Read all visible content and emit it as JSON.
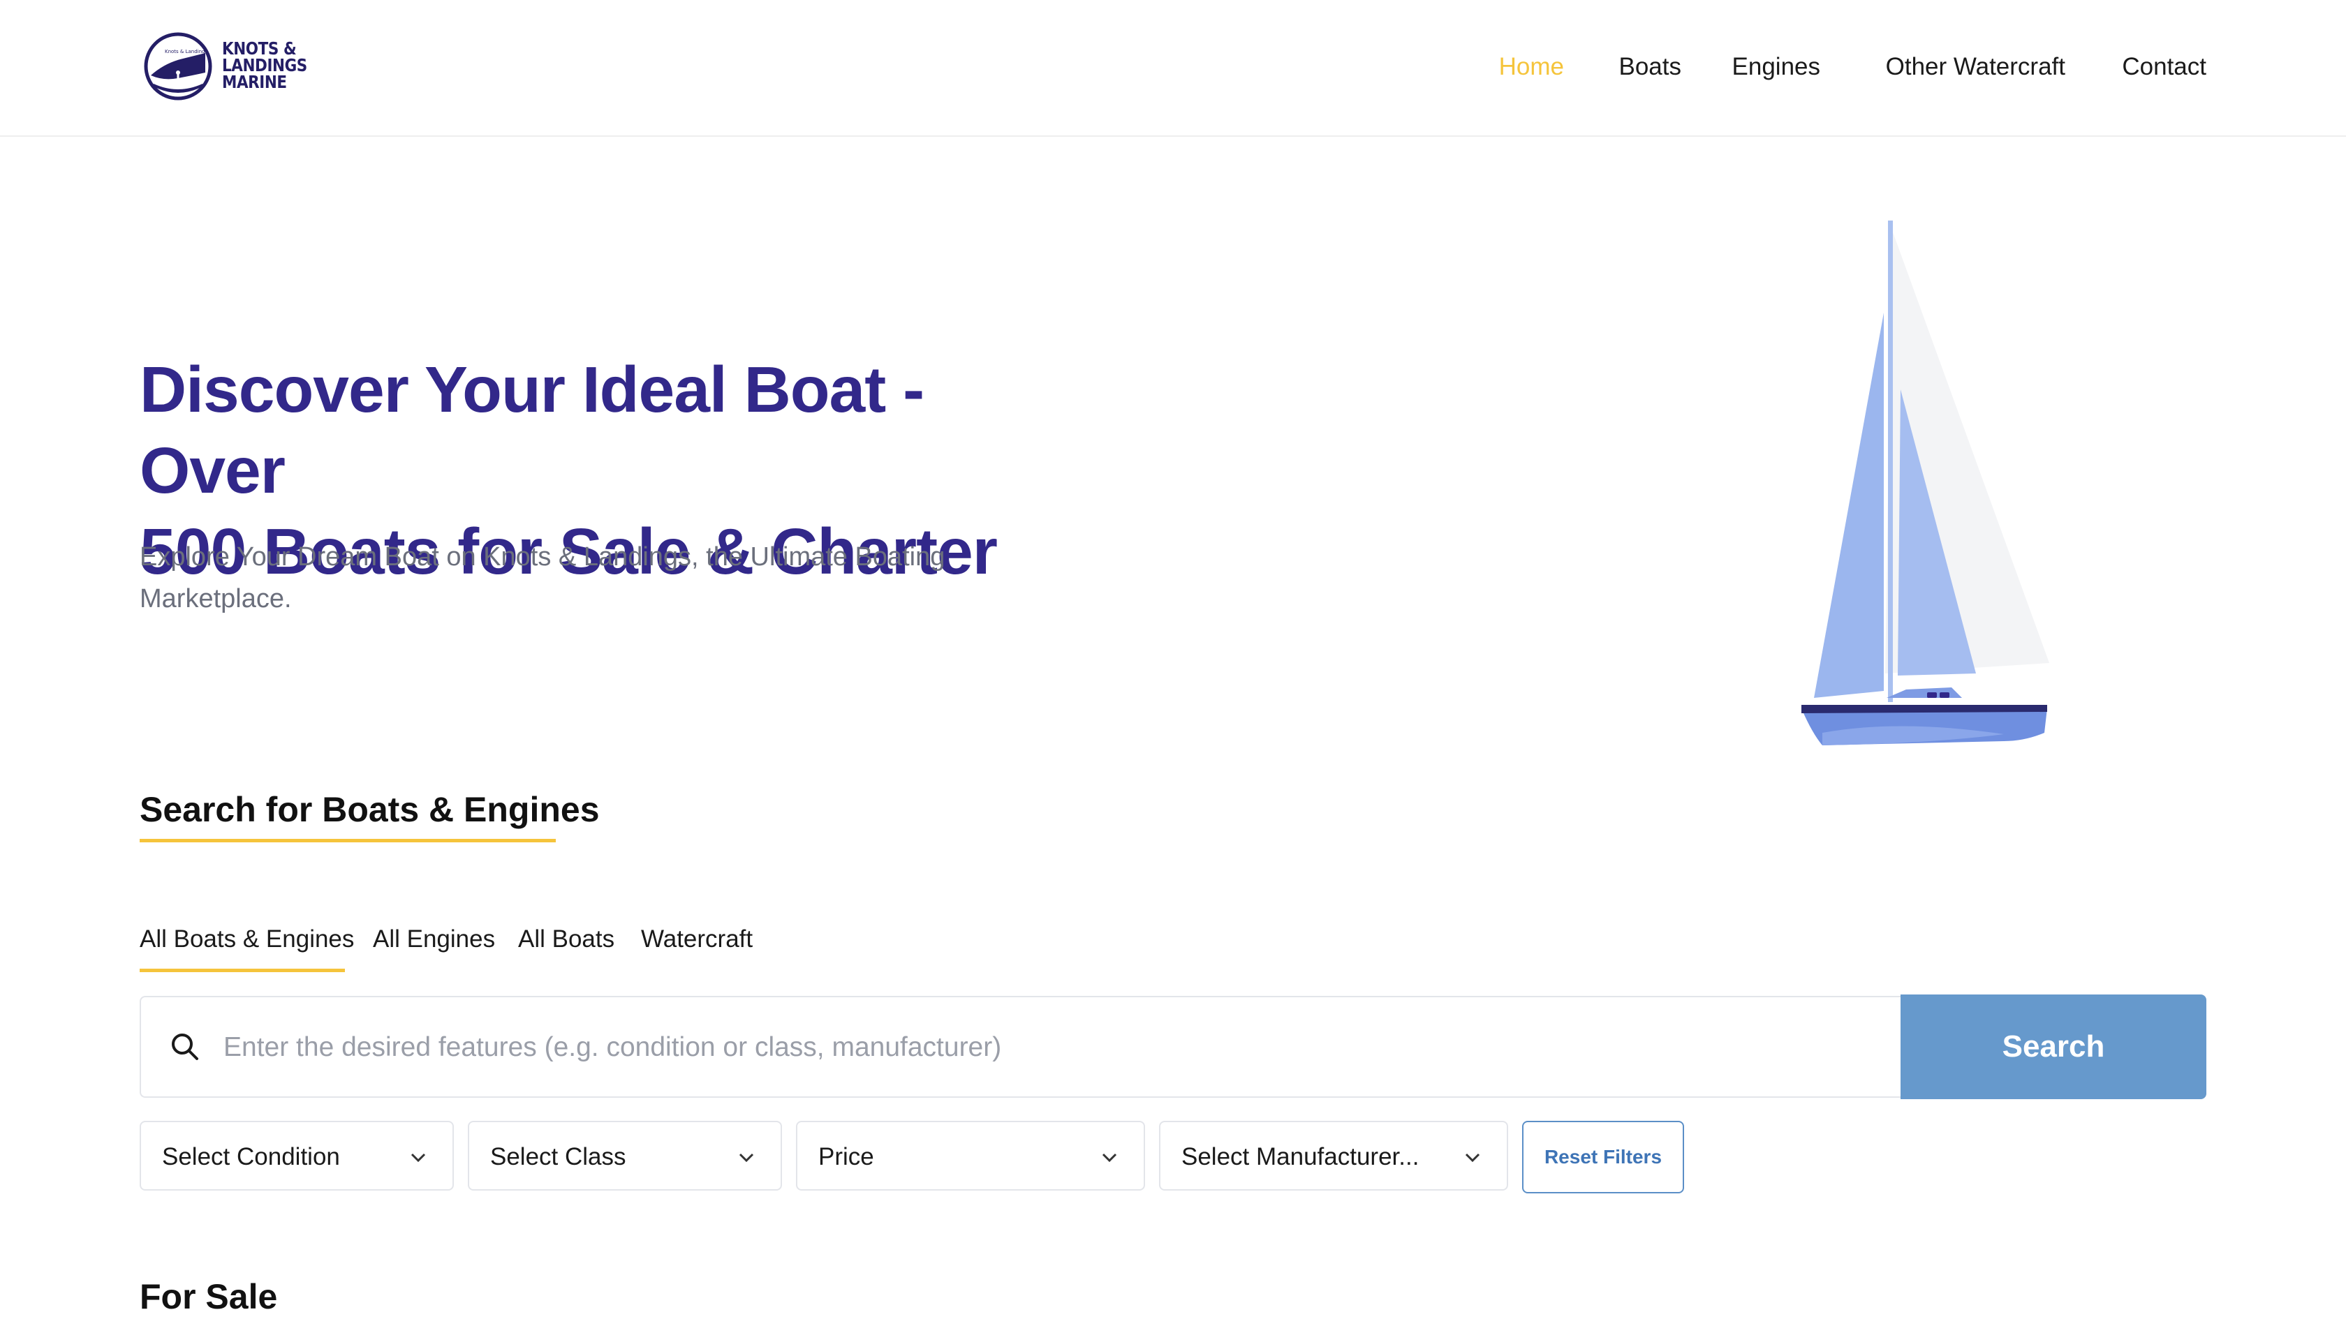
{
  "brand": {
    "logo_lines": [
      "KNOTS &",
      "LANDINGS",
      "MARINE"
    ]
  },
  "nav": {
    "items": [
      {
        "label": "Home",
        "active": true
      },
      {
        "label": "Boats",
        "active": false
      },
      {
        "label": "Engines",
        "active": false
      },
      {
        "label": "Other Watercraft",
        "active": false
      },
      {
        "label": "Contact",
        "active": false
      }
    ]
  },
  "hero": {
    "title_line1": "Discover Your Ideal Boat - Over",
    "title_line2": "500 Boats for Sale & Charter",
    "subtitle_line1": "Explore Your Dream Boat on Knots & Landings, the Ultimate Boating",
    "subtitle_line2": "Marketplace.",
    "illustration_icon": "sailboat-illustration"
  },
  "search": {
    "section_title": "Search for Boats & Engines",
    "tabs": [
      {
        "label": "All Boats & Engines",
        "active": true
      },
      {
        "label": "All Engines",
        "active": false
      },
      {
        "label": "All Boats",
        "active": false
      },
      {
        "label": "Watercraft",
        "active": false
      }
    ],
    "input_placeholder": "Enter the desired features (e.g. condition or class, manufacturer)",
    "input_value": "",
    "search_button_label": "Search",
    "filters": [
      {
        "label": "Select Condition"
      },
      {
        "label": "Select Class"
      },
      {
        "label": "Price"
      },
      {
        "label": "Select Manufacturer..."
      }
    ],
    "reset_label": "Reset Filters"
  },
  "next_section": {
    "title": "For Sale"
  },
  "colors": {
    "accent_yellow": "#f5c43b",
    "brand_purple": "#32288a",
    "search_button_blue": "#6699cc",
    "reset_border_blue": "#5b8fc7",
    "sail_blue": "#9bb6ee",
    "hull_blue": "#6f8fe0"
  }
}
